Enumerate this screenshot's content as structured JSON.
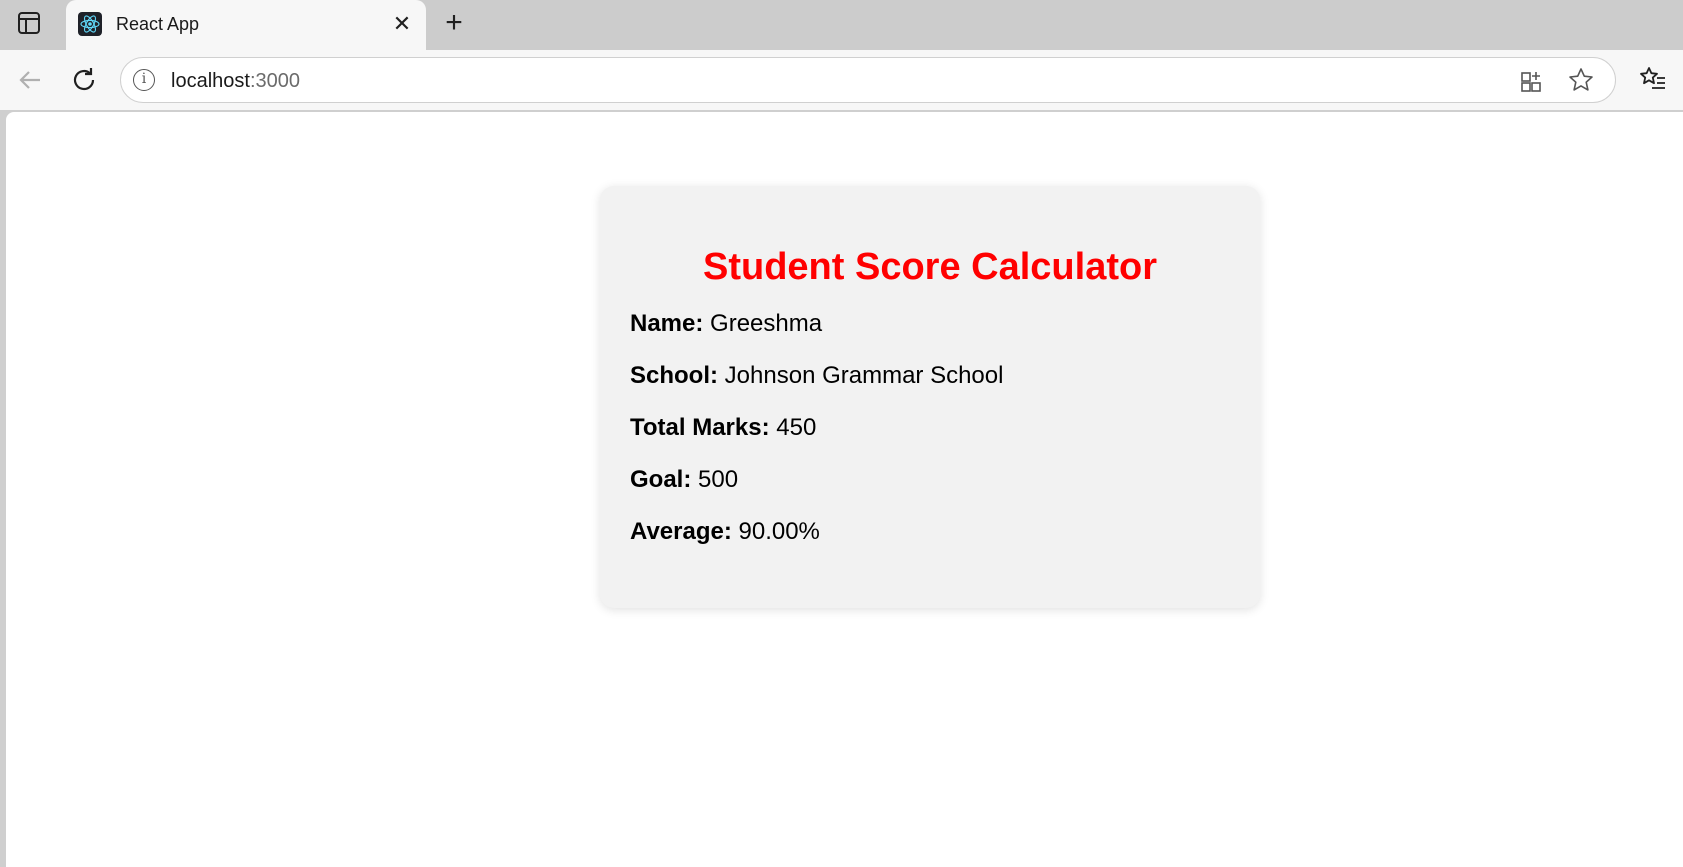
{
  "browser": {
    "tab_title": "React App",
    "tab_close": "✕",
    "new_tab": "+",
    "url_host": "localhost",
    "url_port": ":3000"
  },
  "card": {
    "title": "Student Score Calculator",
    "fields": [
      {
        "label": "Name:",
        "value": "Greeshma"
      },
      {
        "label": "School:",
        "value": "Johnson Grammar School"
      },
      {
        "label": "Total Marks:",
        "value": "450"
      },
      {
        "label": "Goal:",
        "value": "500"
      },
      {
        "label": "Average:",
        "value": "90.00%"
      }
    ]
  },
  "colors": {
    "title": "#ff0000",
    "card_bg": "#f2f2f2"
  },
  "icons": {
    "sidebar": "sidebar-toggle-icon",
    "favicon": "react-logo-icon",
    "back": "back-arrow-icon",
    "reload": "reload-icon",
    "info": "site-info-icon",
    "app_install": "app-install-icon",
    "favorite": "star-icon",
    "favorites": "favorites-list-icon"
  }
}
